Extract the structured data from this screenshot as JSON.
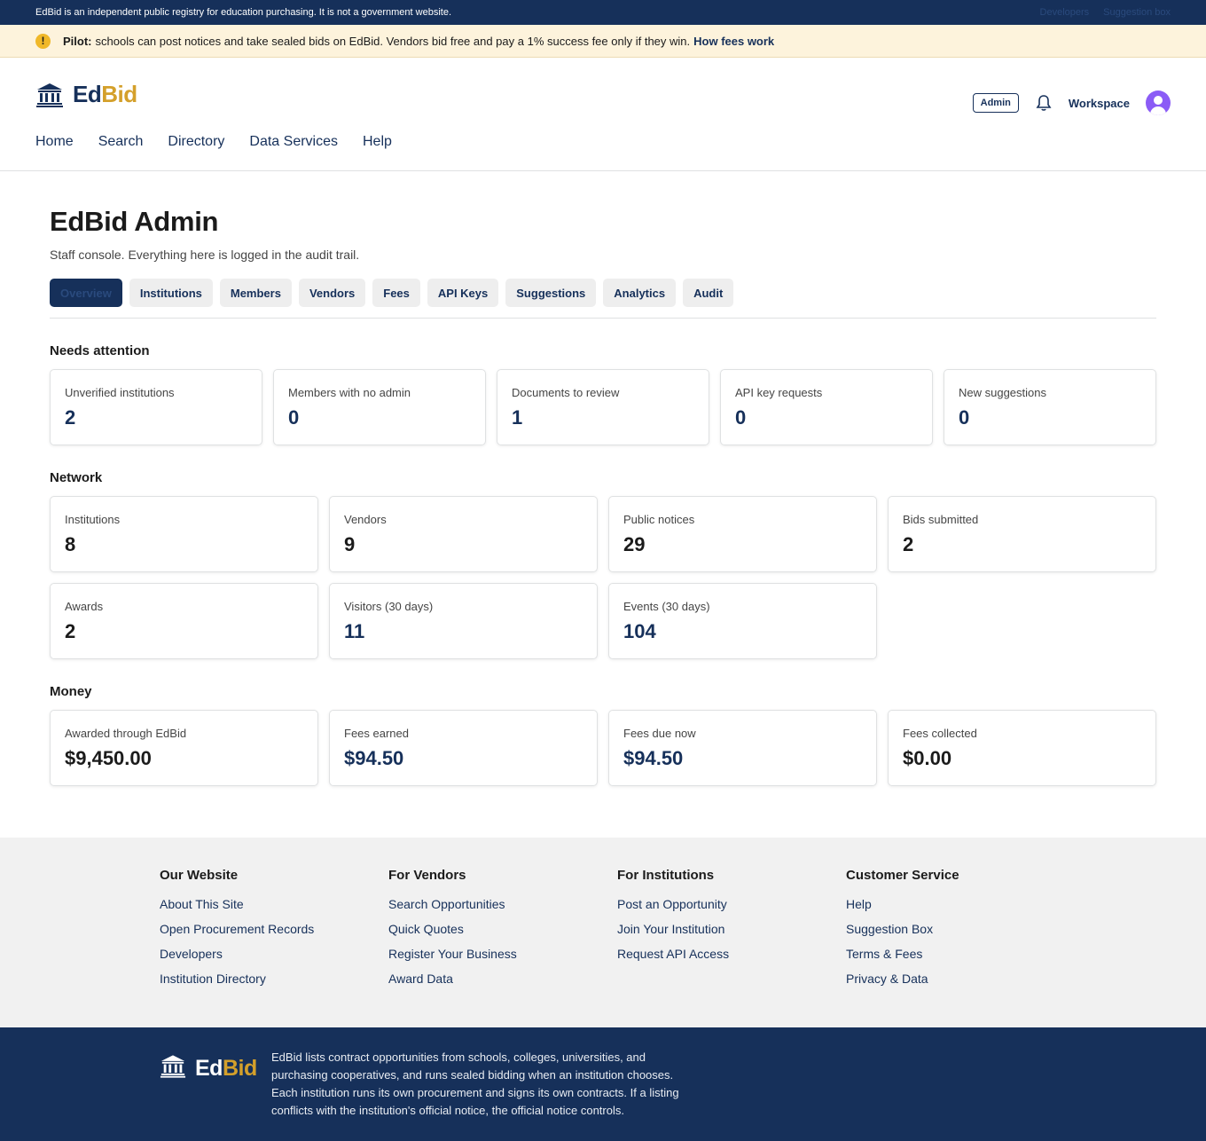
{
  "topbar": {
    "notice": "EdBid is an independent public registry for education purchasing. It is not a government website.",
    "links": [
      "Developers",
      "Suggestion box"
    ]
  },
  "pilot": {
    "label": "Pilot:",
    "text": "schools can post notices and take sealed bids on EdBid. Vendors bid free and pay a 1% success fee only if they win.",
    "link": "How fees work",
    "icon_glyph": "!"
  },
  "brand": {
    "name_part1": "Ed",
    "name_part2": "Bid",
    "icon": "building-icon"
  },
  "header": {
    "admin_badge": "Admin",
    "workspace": "Workspace",
    "icons": [
      "bell-icon",
      "avatar"
    ]
  },
  "nav": [
    "Home",
    "Search",
    "Directory",
    "Data Services",
    "Help"
  ],
  "page": {
    "title": "EdBid Admin",
    "subtitle": "Staff console. Everything here is logged in the audit trail."
  },
  "tabs": [
    {
      "label": "Overview",
      "active": true
    },
    {
      "label": "Institutions"
    },
    {
      "label": "Members"
    },
    {
      "label": "Vendors"
    },
    {
      "label": "Fees"
    },
    {
      "label": "API Keys"
    },
    {
      "label": "Suggestions"
    },
    {
      "label": "Analytics"
    },
    {
      "label": "Audit"
    }
  ],
  "sections": {
    "attention": {
      "title": "Needs attention",
      "cards": [
        {
          "label": "Unverified institutions",
          "value": "2"
        },
        {
          "label": "Members with no admin",
          "value": "0"
        },
        {
          "label": "Documents to review",
          "value": "1"
        },
        {
          "label": "API key requests",
          "value": "0"
        },
        {
          "label": "New suggestions",
          "value": "0"
        }
      ]
    },
    "network": {
      "title": "Network",
      "cards": [
        {
          "label": "Institutions",
          "value": "8"
        },
        {
          "label": "Vendors",
          "value": "9"
        },
        {
          "label": "Public notices",
          "value": "29"
        },
        {
          "label": "Bids submitted",
          "value": "2"
        },
        {
          "label": "Awards",
          "value": "2"
        },
        {
          "label": "Visitors (30 days)",
          "value": "11"
        },
        {
          "label": "Events (30 days)",
          "value": "104"
        }
      ]
    },
    "money": {
      "title": "Money",
      "cards": [
        {
          "label": "Awarded through EdBid",
          "value": "$9,450.00"
        },
        {
          "label": "Fees earned",
          "value": "$94.50"
        },
        {
          "label": "Fees due now",
          "value": "$94.50"
        },
        {
          "label": "Fees collected",
          "value": "$0.00"
        }
      ]
    }
  },
  "footer": {
    "columns": [
      {
        "title": "Our Website",
        "links": [
          "About This Site",
          "Open Procurement Records",
          "Developers",
          "Institution Directory"
        ]
      },
      {
        "title": "For Vendors",
        "links": [
          "Search Opportunities",
          "Quick Quotes",
          "Register Your Business",
          "Award Data"
        ]
      },
      {
        "title": "For Institutions",
        "links": [
          "Post an Opportunity",
          "Join Your Institution",
          "Request API Access"
        ]
      },
      {
        "title": "Customer Service",
        "links": [
          "Help",
          "Suggestion Box",
          "Terms & Fees",
          "Privacy & Data"
        ]
      }
    ],
    "description": "EdBid lists contract opportunities from schools, colleges, universities, and purchasing cooperatives, and runs sealed bidding when an institution chooses. Each institution runs its own procurement and signs its own contracts. If a listing conflicts with the institution's official notice, the official notice controls."
  },
  "colors": {
    "navy": "#16305a",
    "gold": "#d4a02b",
    "pilot_bg": "#fdf3dc",
    "footer_bg": "#f1f1f1",
    "avatar": "#8b5cf6"
  }
}
